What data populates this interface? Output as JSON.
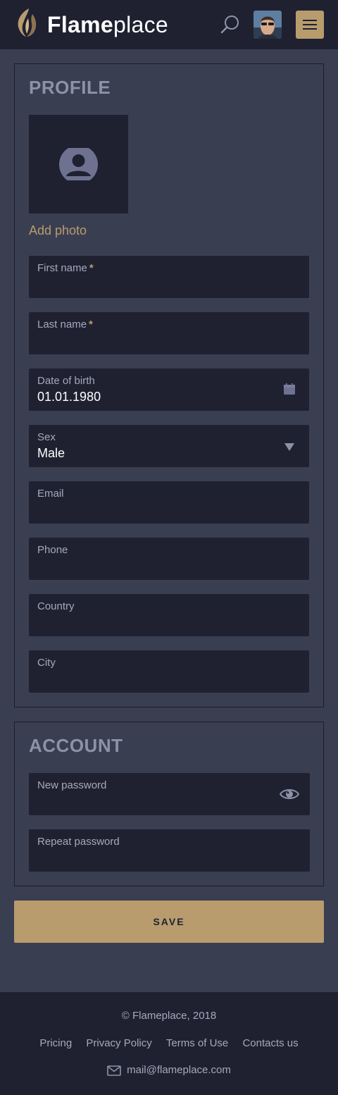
{
  "brand": {
    "name_bold": "Flame",
    "name_light": "place"
  },
  "header": {
    "search_icon": "search-icon",
    "menu_icon": "hamburger-icon",
    "avatar": "user-avatar"
  },
  "profile": {
    "title": "PROFILE",
    "add_photo": "Add photo",
    "photo_icon": "user-silhouette-icon",
    "fields": [
      {
        "label": "First name",
        "required": "*",
        "value": ""
      },
      {
        "label": "Last name",
        "required": "*",
        "value": ""
      },
      {
        "label": "Date of birth",
        "value": "01.01.1980",
        "icon": "calendar-icon"
      },
      {
        "label": "Sex",
        "value": "Male",
        "icon": "dropdown-arrow-icon"
      },
      {
        "label": "Email",
        "value": ""
      },
      {
        "label": "Phone",
        "value": ""
      },
      {
        "label": "Country",
        "value": ""
      },
      {
        "label": "City",
        "value": ""
      }
    ]
  },
  "account": {
    "title": "ACCOUNT",
    "fields": [
      {
        "label": "New password",
        "value": "",
        "icon": "eye-icon"
      },
      {
        "label": "Repeat password",
        "value": ""
      }
    ]
  },
  "save_label": "SAVE",
  "footer": {
    "copyright": "© Flameplace, 2018",
    "links": [
      "Pricing",
      "Privacy Policy",
      "Terms of Use",
      "Contacts us"
    ],
    "email": "mail@flameplace.com",
    "email_icon": "envelope-icon"
  },
  "colors": {
    "accent": "#b89c6e",
    "header_bg": "#1f2131",
    "page_bg": "#3a3e51",
    "field_bg": "#1f2131"
  }
}
